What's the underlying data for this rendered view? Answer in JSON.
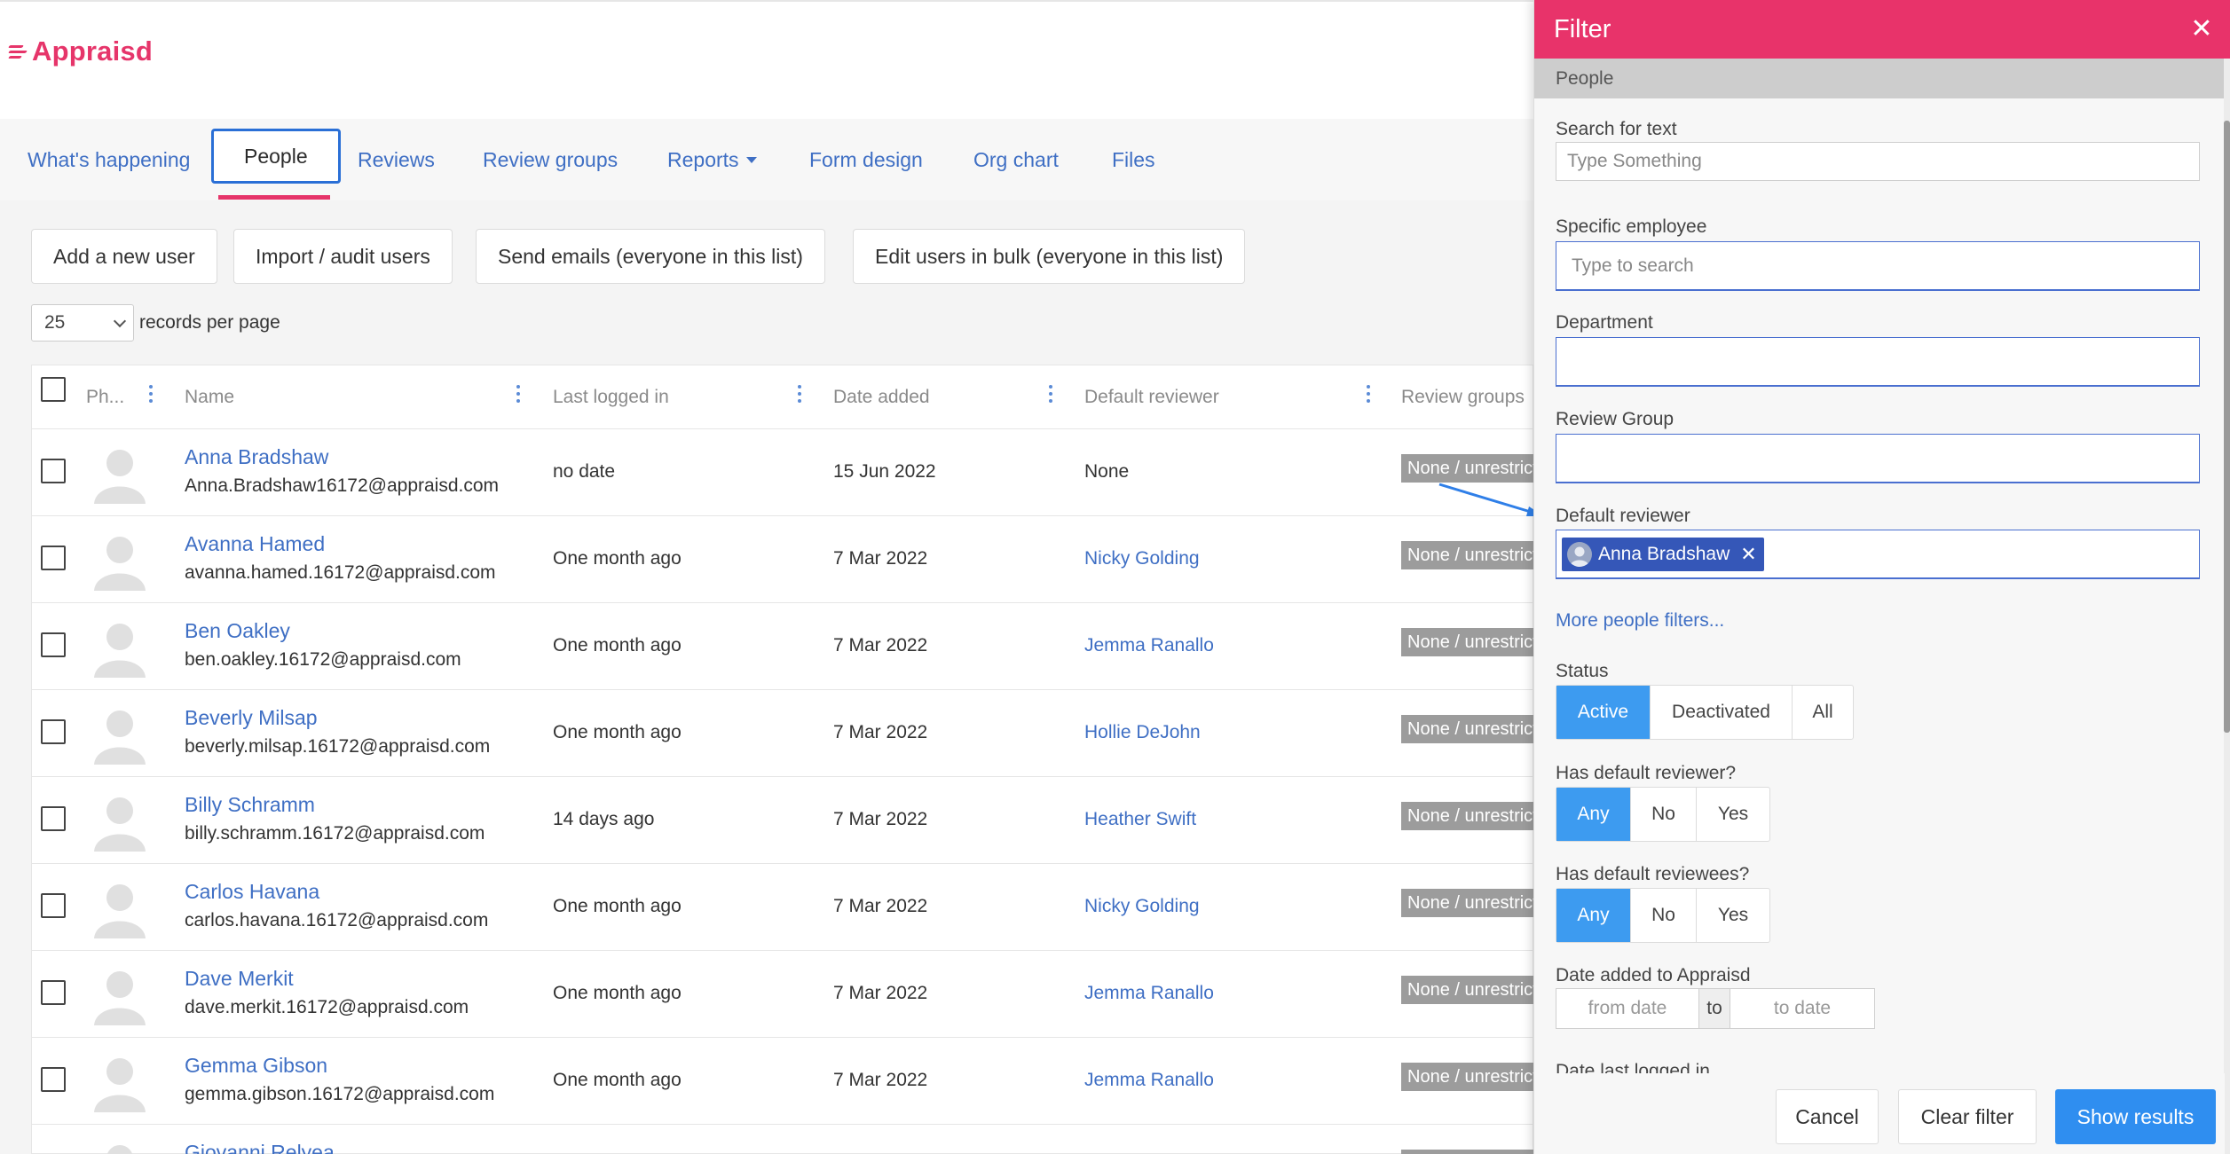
{
  "app": {
    "brand": "Appraisd"
  },
  "nav": {
    "items": [
      {
        "label": "What's happening"
      },
      {
        "label": "People"
      },
      {
        "label": "Reviews"
      },
      {
        "label": "Review groups"
      },
      {
        "label": "Reports"
      },
      {
        "label": "Form design"
      },
      {
        "label": "Org chart"
      },
      {
        "label": "Files"
      }
    ]
  },
  "toolbar": {
    "add_user": "Add a new user",
    "import_users": "Import / audit users",
    "send_emails": "Send emails (everyone in this list)",
    "edit_bulk": "Edit users in bulk (everyone in this list)"
  },
  "pagination": {
    "per_page_value": "25",
    "per_page_label": "records per page"
  },
  "table": {
    "headers": {
      "photo": "Ph...",
      "name": "Name",
      "last_logged_in": "Last logged in",
      "date_added": "Date added",
      "default_reviewer": "Default reviewer",
      "review_groups": "Review groups"
    },
    "rows": [
      {
        "name": "Anna Bradshaw",
        "email": "Anna.Bradshaw16172@appraisd.com",
        "last": "no date",
        "added": "15 Jun 2022",
        "reviewer": "None",
        "group": "None / unrestricted"
      },
      {
        "name": "Avanna Hamed",
        "email": "avanna.hamed.16172@appraisd.com",
        "last": "One month ago",
        "added": "7 Mar 2022",
        "reviewer": "Nicky Golding",
        "group": "None / unrestricted"
      },
      {
        "name": "Ben Oakley",
        "email": "ben.oakley.16172@appraisd.com",
        "last": "One month ago",
        "added": "7 Mar 2022",
        "reviewer": "Jemma Ranallo",
        "group": "None / unrestricted"
      },
      {
        "name": "Beverly Milsap",
        "email": "beverly.milsap.16172@appraisd.com",
        "last": "One month ago",
        "added": "7 Mar 2022",
        "reviewer": "Hollie DeJohn",
        "group": "None / unrestricted"
      },
      {
        "name": "Billy Schramm",
        "email": "billy.schramm.16172@appraisd.com",
        "last": "14 days ago",
        "added": "7 Mar 2022",
        "reviewer": "Heather Swift",
        "group": "None / unrestricted"
      },
      {
        "name": "Carlos Havana",
        "email": "carlos.havana.16172@appraisd.com",
        "last": "One month ago",
        "added": "7 Mar 2022",
        "reviewer": "Nicky Golding",
        "group": "None / unrestricted"
      },
      {
        "name": "Dave Merkit",
        "email": "dave.merkit.16172@appraisd.com",
        "last": "One month ago",
        "added": "7 Mar 2022",
        "reviewer": "Jemma Ranallo",
        "group": "None / unrestricted"
      },
      {
        "name": "Gemma Gibson",
        "email": "gemma.gibson.16172@appraisd.com",
        "last": "One month ago",
        "added": "7 Mar 2022",
        "reviewer": "Jemma Ranallo",
        "group": "None / unrestricted"
      },
      {
        "name": "Giovanni Relyea",
        "email": "",
        "last": "",
        "added": "",
        "reviewer": "",
        "group": "None / unrestricted"
      }
    ]
  },
  "filter": {
    "title": "Filter",
    "section": "People",
    "search_label": "Search for text",
    "search_placeholder": "Type Something",
    "employee_label": "Specific employee",
    "employee_placeholder": "Type to search",
    "department_label": "Department",
    "review_group_label": "Review Group",
    "default_reviewer_label": "Default reviewer",
    "selected_reviewer": "Anna Bradshaw",
    "more_filters": "More people filters...",
    "status_label": "Status",
    "status_options": [
      "Active",
      "Deactivated",
      "All"
    ],
    "has_reviewer_label": "Has default reviewer?",
    "has_reviewer_options": [
      "Any",
      "No",
      "Yes"
    ],
    "has_reviewees_label": "Has default reviewees?",
    "has_reviewees_options": [
      "Any",
      "No",
      "Yes"
    ],
    "date_added_label": "Date added to Appraisd",
    "from_date": "from date",
    "to": "to",
    "to_date": "to date",
    "date_logged_label": "Date last logged in",
    "cancel": "Cancel",
    "clear": "Clear filter",
    "show": "Show results"
  },
  "colors": {
    "brand": "#e8336a",
    "link": "#3f6fc4",
    "primary": "#2f8ef0",
    "toggle_on": "#3d9bf0",
    "chip": "#3557b8"
  }
}
